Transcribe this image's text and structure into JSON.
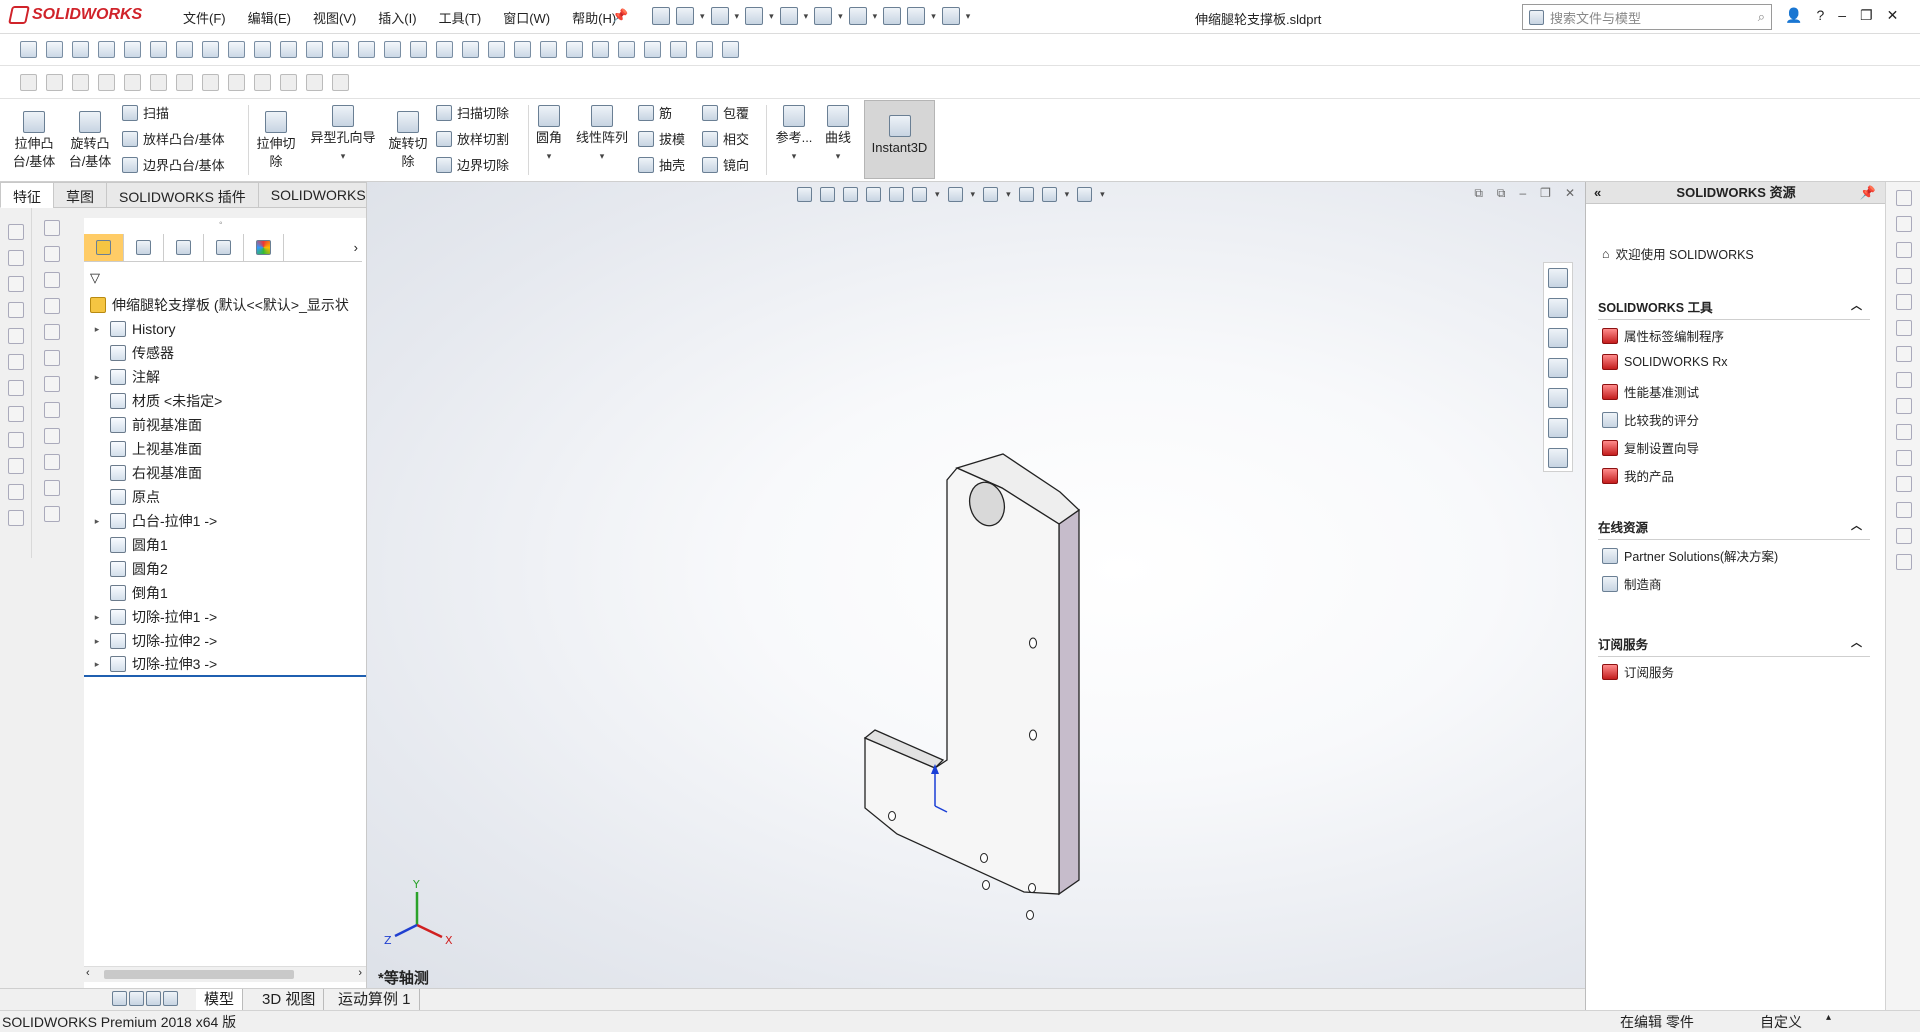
{
  "app": {
    "brand": "SOLIDWORKS",
    "doc_title": "伸缩腿轮支撑板.sldprt"
  },
  "menu": [
    "文件(F)",
    "编辑(E)",
    "视图(V)",
    "插入(I)",
    "工具(T)",
    "窗口(W)",
    "帮助(H)"
  ],
  "search": {
    "placeholder": "搜索文件与模型"
  },
  "ribbon": {
    "extrude_boss": "拉伸凸\n台/基体",
    "revolve_boss": "旋转凸\n台/基体",
    "sweep": "扫描",
    "loft_boss": "放样凸台/基体",
    "boundary_boss": "边界凸台/基体",
    "extrude_cut": "拉伸切\n除",
    "hole_wizard": "异型孔向导",
    "revolve_cut": "旋转切\n除",
    "swept_cut": "扫描切除",
    "lofted_cut": "放样切割",
    "boundary_cut": "边界切除",
    "fillet": "圆角",
    "linear_pattern": "线性阵列",
    "rib": "筋",
    "draft": "拔模",
    "shell": "抽壳",
    "wrap": "包覆",
    "intersect": "相交",
    "mirror": "镜向",
    "reference": "参考...",
    "curves": "曲线",
    "instant3d": "Instant3D"
  },
  "tabs": [
    "特征",
    "草图",
    "SOLIDWORKS 插件",
    "SOLIDWORKS MBD"
  ],
  "tree": [
    {
      "label": "伸缩腿轮支撑板 (默认<<默认>_显示状",
      "expander": ""
    },
    {
      "label": "History",
      "expander": "▸"
    },
    {
      "label": "传感器",
      "expander": ""
    },
    {
      "label": "注解",
      "expander": "▸"
    },
    {
      "label": "材质 <未指定>",
      "expander": ""
    },
    {
      "label": "前视基准面",
      "expander": ""
    },
    {
      "label": "上视基准面",
      "expander": ""
    },
    {
      "label": "右视基准面",
      "expander": ""
    },
    {
      "label": "原点",
      "expander": ""
    },
    {
      "label": "凸台-拉伸1 ->",
      "expander": "▸"
    },
    {
      "label": "圆角1",
      "expander": ""
    },
    {
      "label": "圆角2",
      "expander": ""
    },
    {
      "label": "倒角1",
      "expander": ""
    },
    {
      "label": "切除-拉伸1 ->",
      "expander": "▸"
    },
    {
      "label": "切除-拉伸2 ->",
      "expander": "▸"
    },
    {
      "label": "切除-拉伸3 ->",
      "expander": "▸"
    }
  ],
  "viewport": {
    "view_label": "*等轴测",
    "triad": {
      "x": "X",
      "y": "Y",
      "z": "Z"
    }
  },
  "bottom_tabs": [
    "模型",
    "3D 视图",
    "运动算例 1"
  ],
  "status": {
    "left": "SOLIDWORKS Premium 2018 x64 版",
    "mode": "在编辑 零件",
    "custom": "自定义"
  },
  "task_pane": {
    "title": "SOLIDWORKS 资源",
    "welcome": "欢迎使用  SOLIDWORKS",
    "tools_header": "SOLIDWORKS 工具",
    "tools": [
      "属性标签编制程序",
      "SOLIDWORKS Rx",
      "性能基准测试",
      "比较我的评分",
      "复制设置向导",
      "我的产品"
    ],
    "online_header": "在线资源",
    "online": [
      "Partner Solutions(解决方案)",
      "制造商"
    ],
    "sub_header": "订阅服务",
    "sub": [
      "订阅服务"
    ]
  }
}
